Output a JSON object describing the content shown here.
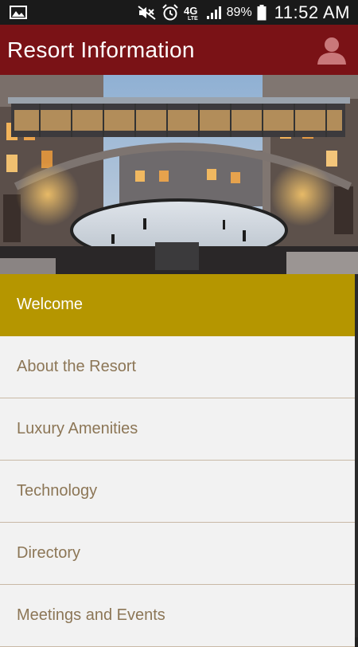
{
  "status_bar": {
    "battery_percent": "89%",
    "time": "11:52 AM",
    "network": "4G LTE",
    "icons": [
      "gallery-icon",
      "mute-icon",
      "alarm-icon",
      "4g-lte-icon",
      "signal-icon",
      "battery-icon"
    ]
  },
  "header": {
    "title": "Resort Information",
    "profile_icon": "person-icon",
    "background": "#7a1216"
  },
  "hero": {
    "icon": "resort-ice-rink-photo"
  },
  "menu": {
    "accent": "#b59600",
    "items": [
      {
        "label": "Welcome",
        "active": true
      },
      {
        "label": "About the Resort",
        "active": false
      },
      {
        "label": "Luxury Amenities",
        "active": false
      },
      {
        "label": "Technology",
        "active": false
      },
      {
        "label": "Directory",
        "active": false
      },
      {
        "label": "Meetings and Events",
        "active": false
      }
    ]
  }
}
